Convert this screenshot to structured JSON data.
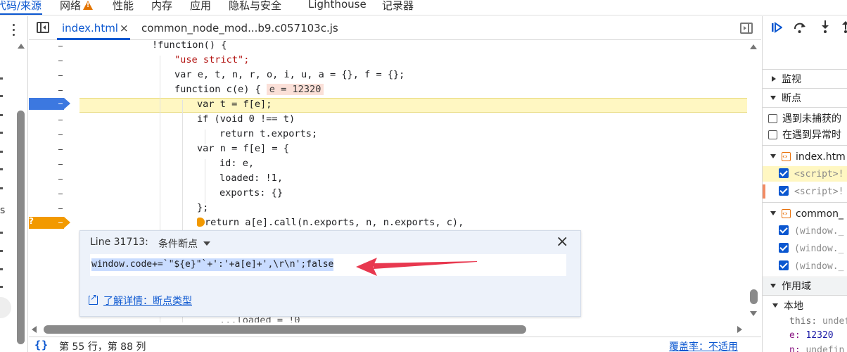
{
  "top_tabs": [
    {
      "label": "代码/来源",
      "active": true
    },
    {
      "label": "网络",
      "warning": true
    },
    {
      "label": "性能"
    },
    {
      "label": "内存"
    },
    {
      "label": "应用"
    },
    {
      "label": "隐私与安全"
    },
    {
      "label": "Lighthouse"
    },
    {
      "label": "记录器"
    }
  ],
  "navigator_letters": [
    "s"
  ],
  "editor": {
    "tabs": [
      {
        "label": "index.html",
        "close": "×",
        "active": true
      },
      {
        "label": "common_node_mod...b9.c057103c.js"
      }
    ]
  },
  "code": {
    "lines": [
      "!function() {",
      "\"use strict\";",
      "var e, t, n, r, o, i, u, a = {}, f = {};",
      "function c(e) {",
      "var t = f[e];",
      "if (void 0 !== t)",
      "return t.exports;",
      "var n = f[e] = {",
      "id: e,",
      "loaded: !1,",
      "exports: {}",
      "};",
      "return a[e].call(n.exports, n, n.exports, c),"
    ],
    "inline_value": "e = 12320",
    "bottom_partial": "...loaded = !0"
  },
  "gutter": {
    "dash": "–",
    "conditional_marker": "?"
  },
  "conditional_breakpoint": {
    "line_label": "Line 31713:",
    "type_label": "条件断点",
    "close": "×",
    "expression": "window.code+=`\"${e}\"`+':'+a[e]+',\\r\\n';false",
    "learn_more": "了解详情：断点类型"
  },
  "status_bar": {
    "cursor_position": "第 55 行，第 88 列",
    "coverage": "覆盖率：不适用"
  },
  "right_panel": {
    "watch_label": "监视",
    "breakpoints_label": "断点",
    "pause_uncaught": "遇到未捕获的",
    "pause_caught": "在遇到异常时",
    "files": [
      {
        "name": "index.htm",
        "breakpoints": [
          "<script>!",
          "<script>!"
        ]
      },
      {
        "name": "common_",
        "breakpoints": [
          "(window._",
          "(window._",
          "(window._"
        ]
      }
    ],
    "scope_label": "作用域",
    "local_label": "本地",
    "scope_vars": [
      {
        "key": "this",
        "value": "undef"
      },
      {
        "key": "e",
        "value": "12320"
      },
      {
        "key": "n",
        "value": "undefin"
      }
    ]
  },
  "colors": {
    "accent": "#0b57d0",
    "breakpoint_blue": "#3c78e0",
    "breakpoint_conditional": "#f29900",
    "execution_line": "#fff7c2",
    "annotation_arrow": "#e8384f"
  }
}
